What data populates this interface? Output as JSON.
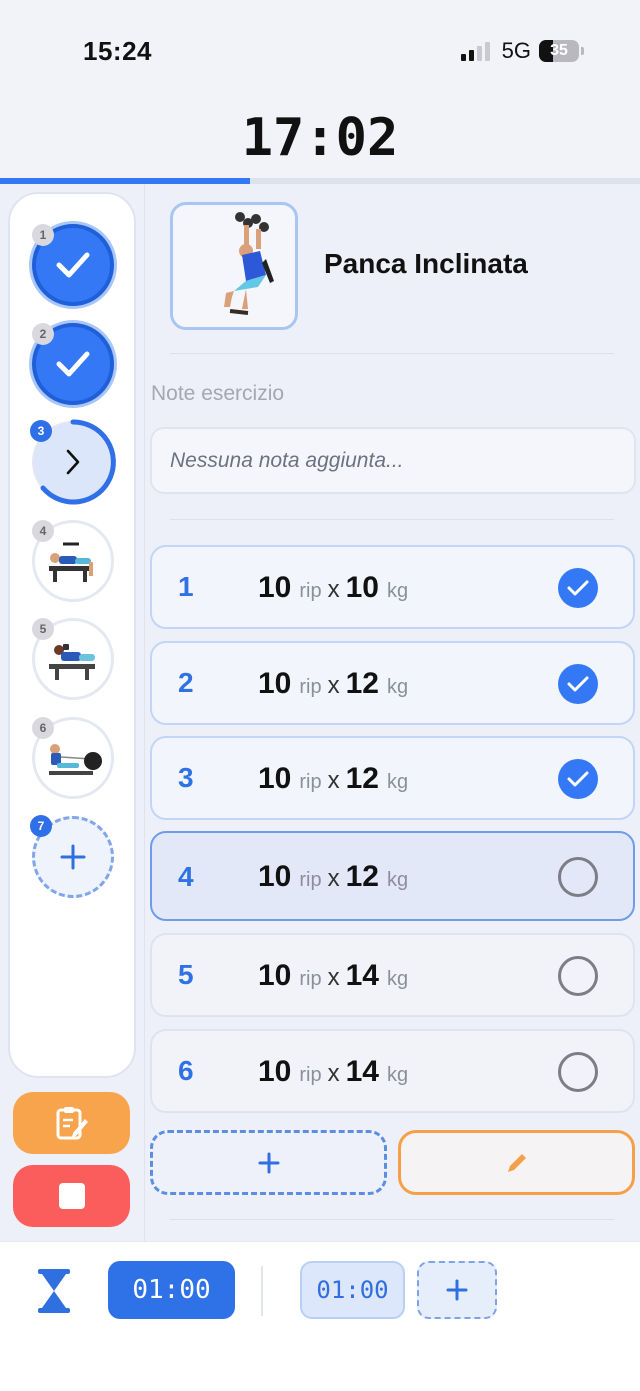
{
  "status_bar": {
    "time": "15:24",
    "network": "5G",
    "battery_level": "35",
    "icons": [
      "signal-icon",
      "battery-icon"
    ]
  },
  "workout": {
    "elapsed_timer": "17:02",
    "progress_fraction": 0.39
  },
  "exercise_list": [
    {
      "number": "1",
      "state": "done"
    },
    {
      "number": "2",
      "state": "done"
    },
    {
      "number": "3",
      "state": "current"
    },
    {
      "number": "4",
      "state": "pending"
    },
    {
      "number": "5",
      "state": "pending"
    },
    {
      "number": "6",
      "state": "pending"
    },
    {
      "number": "7",
      "state": "add"
    }
  ],
  "exercise": {
    "title": "Panca Inclinata",
    "notes_label": "Note esercizio",
    "notes_placeholder": "Nessuna nota aggiunta..."
  },
  "sets": [
    {
      "number": "1",
      "reps": "10",
      "reps_unit": "rip",
      "times": "x",
      "weight": "10",
      "weight_unit": "kg",
      "completed": true
    },
    {
      "number": "2",
      "reps": "10",
      "reps_unit": "rip",
      "times": "x",
      "weight": "12",
      "weight_unit": "kg",
      "completed": true
    },
    {
      "number": "3",
      "reps": "10",
      "reps_unit": "rip",
      "times": "x",
      "weight": "12",
      "weight_unit": "kg",
      "completed": true
    },
    {
      "number": "4",
      "reps": "10",
      "reps_unit": "rip",
      "times": "x",
      "weight": "12",
      "weight_unit": "kg",
      "completed": false
    },
    {
      "number": "5",
      "reps": "10",
      "reps_unit": "rip",
      "times": "x",
      "weight": "14",
      "weight_unit": "kg",
      "completed": false
    },
    {
      "number": "6",
      "reps": "10",
      "reps_unit": "rip",
      "times": "x",
      "weight": "14",
      "weight_unit": "kg",
      "completed": false
    }
  ],
  "rest_timer": {
    "active_value": "01:00",
    "preset_value": "01:00"
  },
  "colors": {
    "accent_blue": "#3478f6",
    "notes_orange": "#f7a44d",
    "stop_red": "#fb5c5c"
  }
}
